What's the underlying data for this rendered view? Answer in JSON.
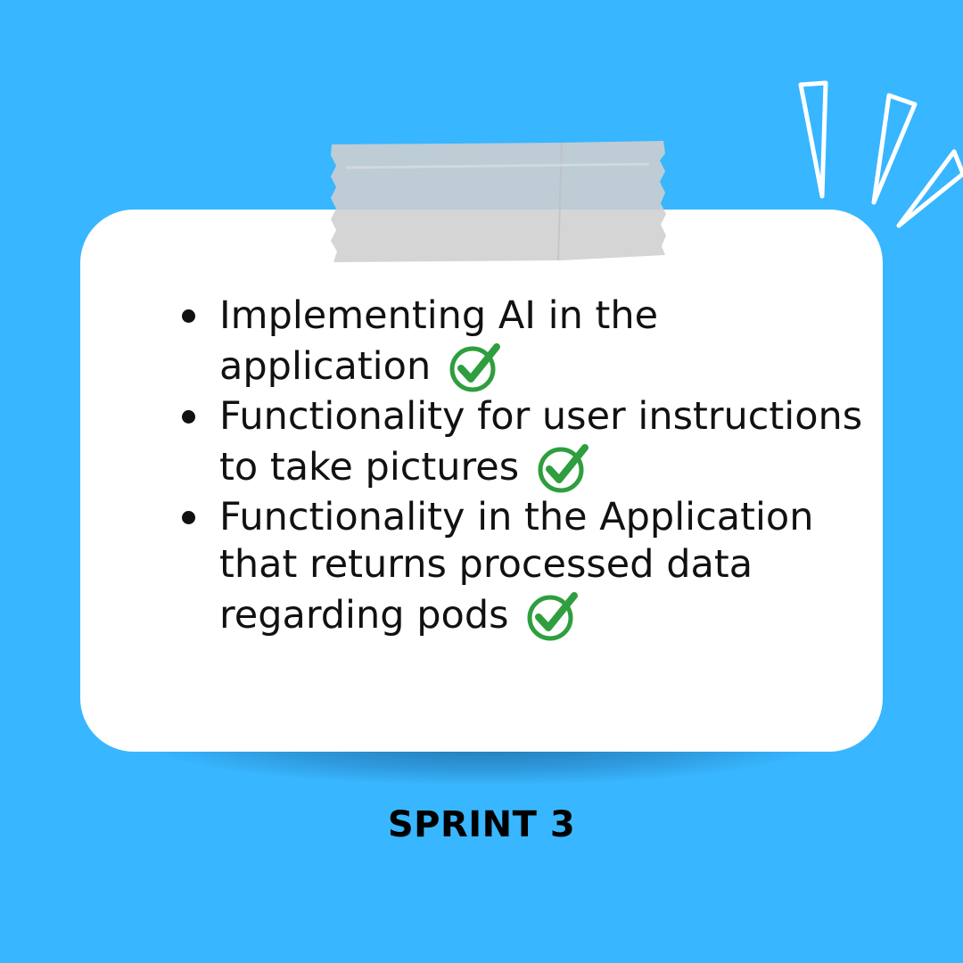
{
  "tasks": [
    {
      "text": "Implementing AI in the application",
      "status_icon": "green-check-circle-icon"
    },
    {
      "text": "Functionality for user instructions to take pictures",
      "status_icon": "green-check-circle-icon"
    },
    {
      "text": "Functionality in the Application that returns processed data regarding pods",
      "status_icon": "green-check-circle-icon"
    }
  ],
  "footer": {
    "label": "SPRINT 3"
  },
  "decorations": {
    "tape": "masking-tape-icon",
    "sparkle": "sparkle-lines-icon"
  },
  "colors": {
    "background": "#38B6FF",
    "card": "#FFFFFF",
    "tape": "#D9D9D9",
    "check": "#2E9E3E",
    "text": "#111111"
  }
}
